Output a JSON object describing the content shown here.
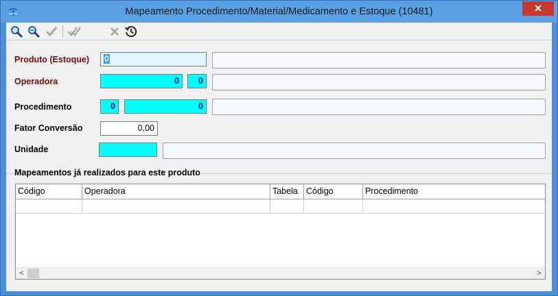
{
  "window": {
    "title": "Mapeamento Procedimento/Material/Medicamento e Estoque (10481)",
    "close_label": "✕"
  },
  "toolbar": {
    "buttons": [
      {
        "name": "search",
        "icon": "magnifier-icon"
      },
      {
        "name": "search-advanced",
        "icon": "magnifier-plus-icon"
      },
      {
        "name": "confirm",
        "icon": "check-icon"
      },
      {
        "name": "confirm-all",
        "icon": "double-check-icon"
      },
      {
        "name": "cancel",
        "icon": "x-icon"
      },
      {
        "name": "history",
        "icon": "history-icon"
      }
    ]
  },
  "form": {
    "produto": {
      "label": "Produto (Estoque)",
      "value": "0",
      "description": ""
    },
    "operadora": {
      "label": "Operadora",
      "value": "0",
      "value2": "0",
      "description": ""
    },
    "procedimento": {
      "label": "Procedimento",
      "value": "0",
      "value2": "0",
      "description": ""
    },
    "fator": {
      "label": "Fator Conversão",
      "value": "0,00"
    },
    "unidade": {
      "label": "Unidade",
      "value": "",
      "description": ""
    }
  },
  "grid": {
    "title": "Mapeamentos já realizados para este produto",
    "columns": [
      "Código",
      "Operadora",
      "Tabela",
      "Código",
      "Procedimento"
    ],
    "scroll_left": "<",
    "scroll_right": ">"
  },
  "colors": {
    "required_label": "#7a0a0a",
    "cyan_field": "#00ffff",
    "titlebar": "#5aa0e4",
    "close": "#c7392f"
  }
}
